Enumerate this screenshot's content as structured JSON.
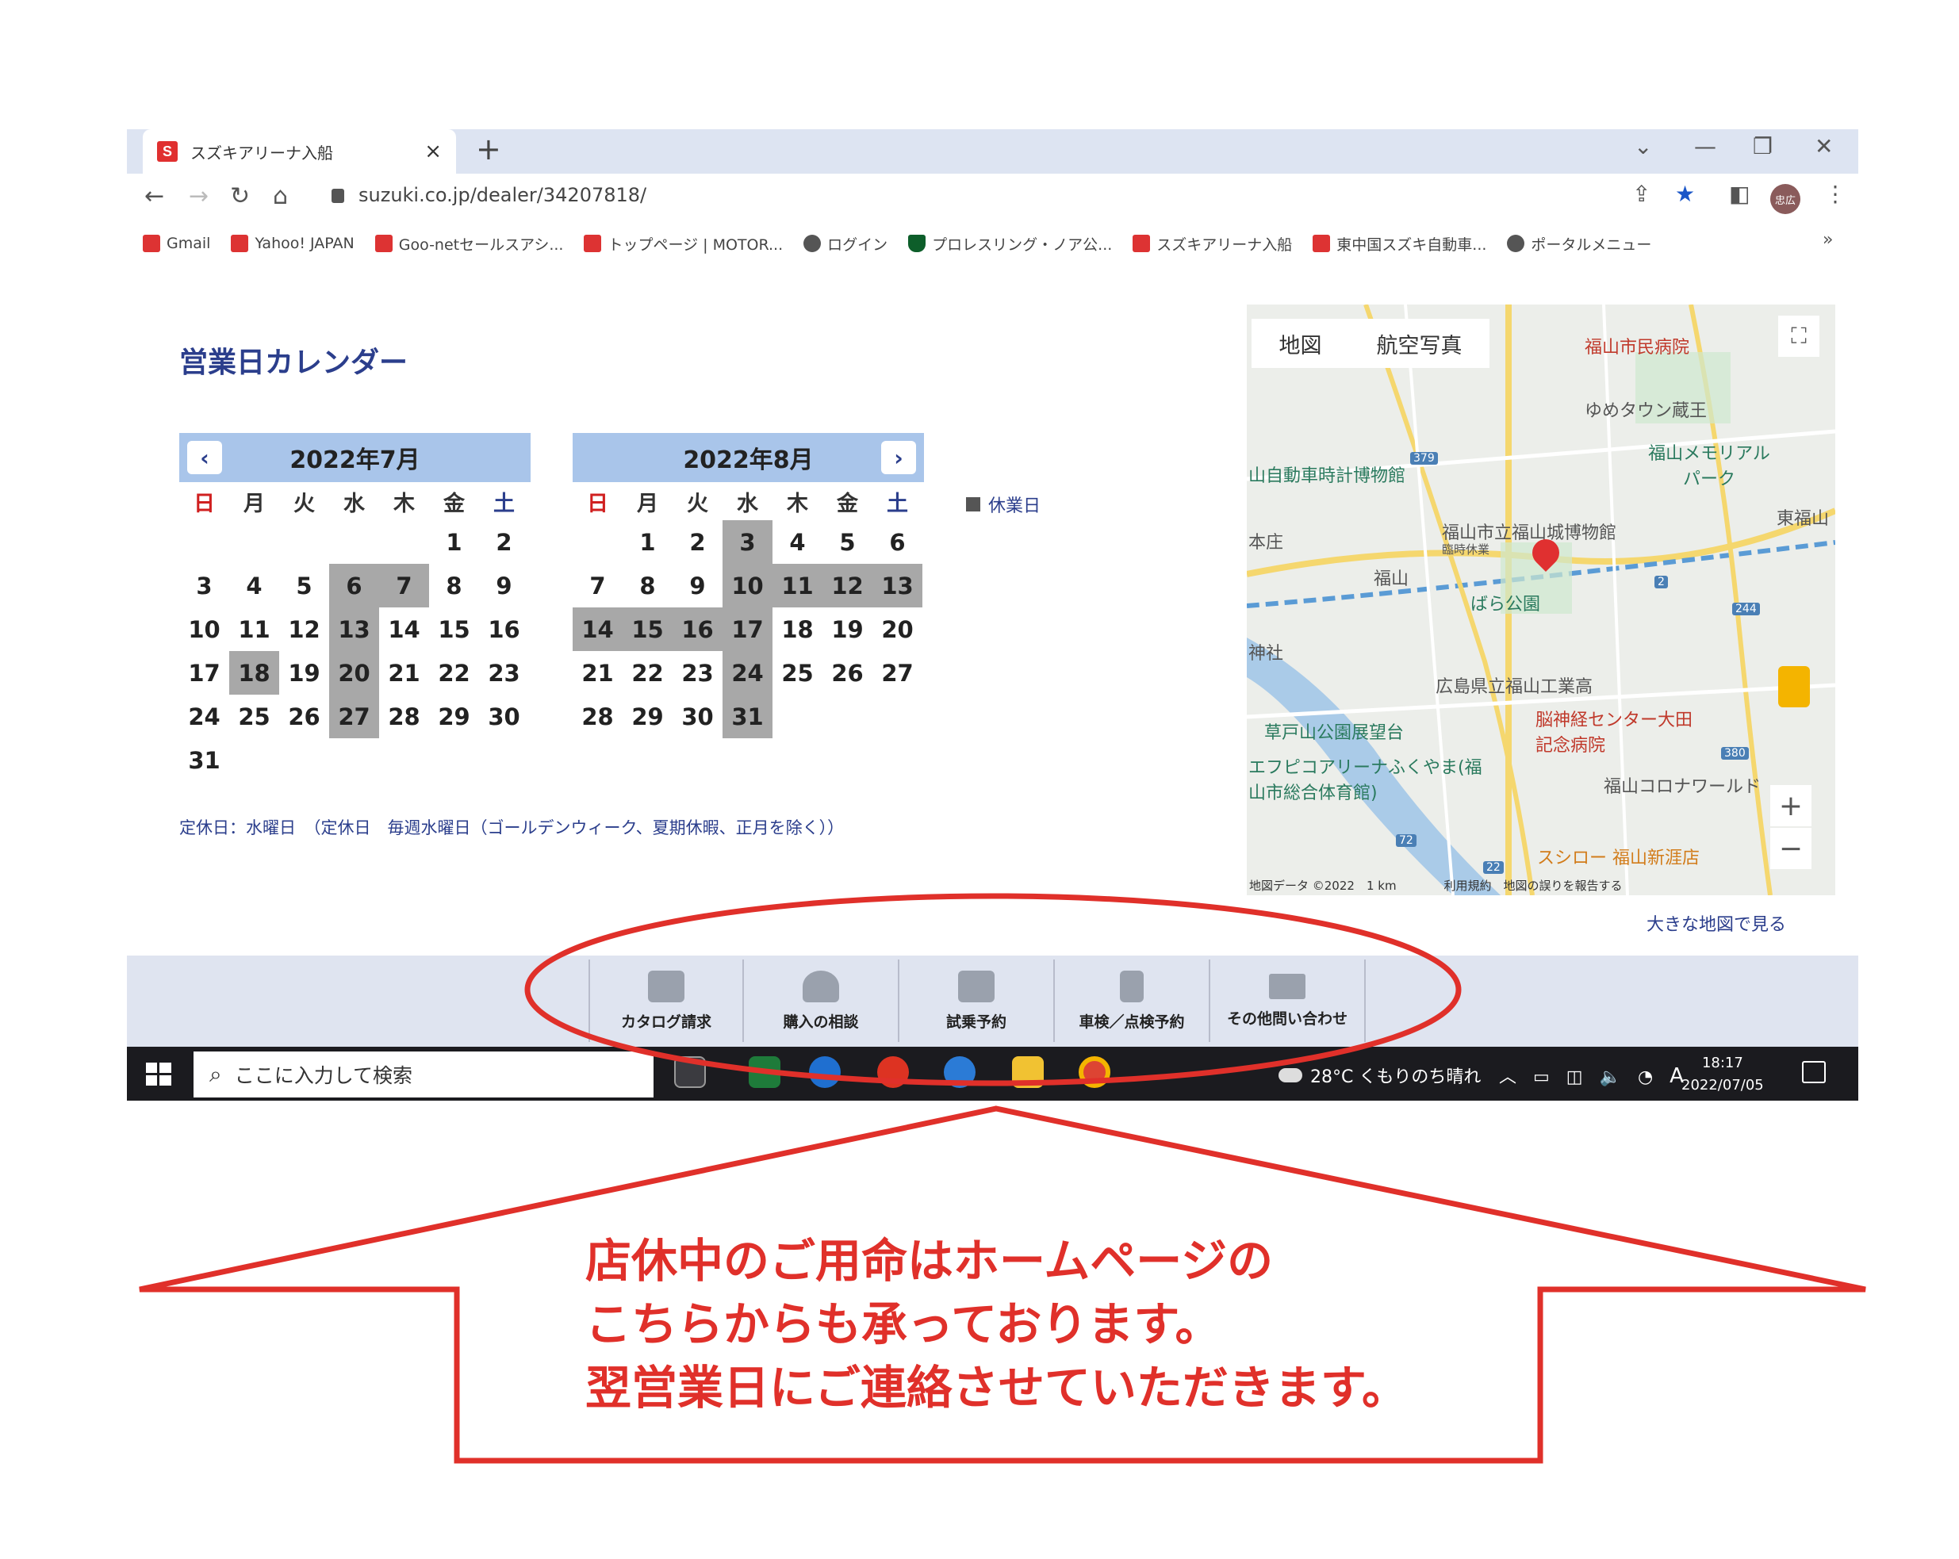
{
  "browser": {
    "tab_title": "スズキアリーナ入船",
    "tab_close": "×",
    "new_tab": "+",
    "url": "suzuki.co.jp/dealer/34207818/",
    "profile": "忠広",
    "bookmarks": [
      {
        "label": "Gmail",
        "icon": "gmail-icon"
      },
      {
        "label": "Yahoo! JAPAN",
        "icon": "yahoo-icon"
      },
      {
        "label": "Goo-netセールスアシ...",
        "icon": "goonet-icon"
      },
      {
        "label": "トップページ | MOTOR...",
        "icon": "car-icon"
      },
      {
        "label": "ログイン",
        "icon": "globe-icon"
      },
      {
        "label": "プロレスリング・ノア公...",
        "icon": "shield-icon"
      },
      {
        "label": "スズキアリーナ入船",
        "icon": "suzuki-icon"
      },
      {
        "label": "東中国スズキ自動車...",
        "icon": "suzuki-icon"
      },
      {
        "label": "ポータルメニュー",
        "icon": "globe-icon"
      }
    ],
    "bookmarks_more": "»"
  },
  "calendar": {
    "title": "営業日カレンダー",
    "weekdays": [
      "日",
      "月",
      "火",
      "水",
      "木",
      "金",
      "土"
    ],
    "legend": "休業日",
    "note": "定休日：水曜日　（定休日　毎週水曜日（ゴールデンウィーク、夏期休暇、正月を除く））",
    "months": [
      {
        "label": "2022年7月",
        "weeks": [
          [
            "",
            "",
            "",
            "",
            "",
            "1",
            "2"
          ],
          [
            "3",
            "4",
            "5",
            "6",
            "7",
            "8",
            "9"
          ],
          [
            "10",
            "11",
            "12",
            "13",
            "14",
            "15",
            "16"
          ],
          [
            "17",
            "18",
            "19",
            "20",
            "21",
            "22",
            "23"
          ],
          [
            "24",
            "25",
            "26",
            "27",
            "28",
            "29",
            "30"
          ],
          [
            "31",
            "",
            "",
            "",
            "",
            "",
            ""
          ]
        ],
        "holidays": [
          "6",
          "7",
          "13",
          "18",
          "20",
          "27"
        ]
      },
      {
        "label": "2022年8月",
        "weeks": [
          [
            "",
            "1",
            "2",
            "3",
            "4",
            "5",
            "6"
          ],
          [
            "7",
            "8",
            "9",
            "10",
            "11",
            "12",
            "13"
          ],
          [
            "14",
            "15",
            "16",
            "17",
            "18",
            "19",
            "20"
          ],
          [
            "21",
            "22",
            "23",
            "24",
            "25",
            "26",
            "27"
          ],
          [
            "28",
            "29",
            "30",
            "31",
            "",
            "",
            ""
          ]
        ],
        "holidays": [
          "3",
          "10",
          "11",
          "12",
          "13",
          "14",
          "15",
          "16",
          "17",
          "24",
          "31"
        ]
      }
    ]
  },
  "map": {
    "tabs": [
      "地図",
      "航空写真"
    ],
    "labels": {
      "hospital": "福山市民病院",
      "youme": "ゆめタウン蔵王",
      "memorial": "福山メモリアルパーク",
      "carmuseum": "山自動車時計博物館",
      "castle": "福山市立福山城博物館",
      "castle_sub": "臨時休業",
      "station": "福山",
      "higashi": "東福山",
      "honjo": "本庄",
      "bara": "ばら公園",
      "jinja": "神社",
      "kogyo": "広島県立福山工業高",
      "kusado": "草戸山公園展望台",
      "brain": "脳神経センター大田記念病院",
      "arena": "エフピコアリーナふくやま(福山市総合体育館)",
      "corona": "福山コロナワールド",
      "sushiro": "スシロー 福山新涯店",
      "r379": "379",
      "r2": "2",
      "r244": "244",
      "r380": "380",
      "r72": "72",
      "r22": "22"
    },
    "attribution": "地図データ ©2022　1 km　　　　利用規約　地図の誤りを報告する",
    "big_map": "大きな地図で見る"
  },
  "footer_nav": [
    {
      "label": "カタログ請求",
      "icon": "book-icon"
    },
    {
      "label": "購入の相談",
      "icon": "person-icon"
    },
    {
      "label": "試乗予約",
      "icon": "car-icon"
    },
    {
      "label": "車検／点検予約",
      "icon": "tools-icon"
    },
    {
      "label": "その他問い合わせ",
      "icon": "mail-icon"
    }
  ],
  "taskbar": {
    "search_placeholder": "ここに入力して検索",
    "weather": "28°C くもりのち晴れ",
    "ime": "A",
    "time": "18:17",
    "date": "2022/07/05"
  },
  "annotation": {
    "lines": [
      "店休中のご用命はホームページの",
      "こちらからも承っております。",
      "翌営業日にご連絡させていただきます。"
    ],
    "color": "#e0302a"
  }
}
